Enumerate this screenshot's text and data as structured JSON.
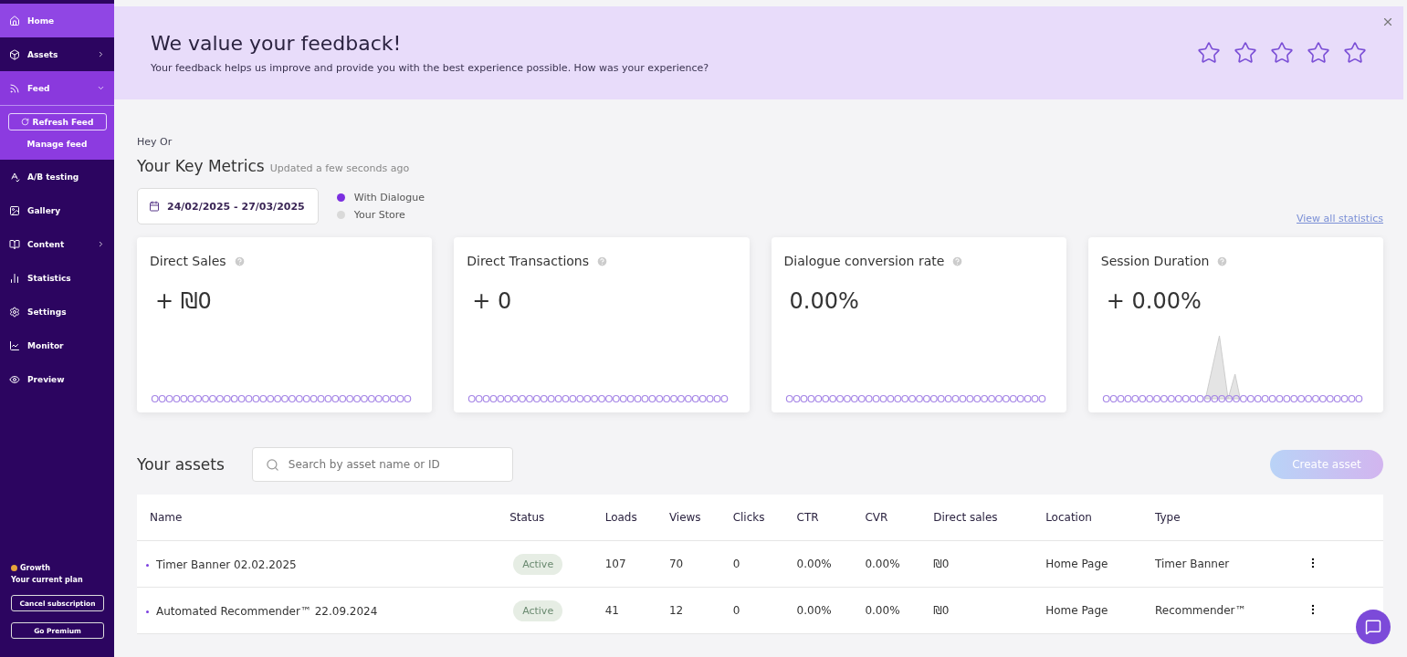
{
  "sidebar": {
    "items": [
      {
        "label": "Home",
        "selected": true
      },
      {
        "label": "Assets",
        "selected": false,
        "expanded": false
      },
      {
        "label": "Feed",
        "selected": false,
        "expanded": true,
        "children": [
          {
            "kind": "button",
            "label": "Refresh Feed"
          },
          {
            "kind": "link",
            "label": "Manage feed"
          }
        ]
      },
      {
        "label": "A/B testing",
        "selected": false
      },
      {
        "label": "Gallery",
        "selected": false
      },
      {
        "label": "Content",
        "selected": false,
        "expanded": false
      },
      {
        "label": "Statistics",
        "selected": false
      },
      {
        "label": "Settings",
        "selected": false
      },
      {
        "label": "Monitor",
        "selected": false
      },
      {
        "label": "Preview",
        "selected": false
      }
    ],
    "plan": {
      "name": "Growth",
      "caption": "Your current plan",
      "buttons": [
        "Cancel subscription",
        "Go Premium"
      ]
    }
  },
  "feedback": {
    "title": "We value your feedback!",
    "text": "Your feedback helps us improve and provide you with the best experience possible. How was your experience?",
    "stars": 0
  },
  "greeting": "Hey Or",
  "metrics": {
    "title": "Your Key Metrics",
    "updated": "Updated a few seconds ago",
    "date_range": "24/02/2025 - 27/03/2025",
    "legend": [
      {
        "label": "With Dialogue",
        "color": "#7b2fe0"
      },
      {
        "label": "Your Store",
        "color": "#d9d9d9"
      }
    ],
    "view_all": "View all statistics",
    "cards": [
      {
        "title": "Direct Sales",
        "value": "+ ₪0",
        "spikes": false
      },
      {
        "title": "Direct Transactions",
        "value": "+ 0",
        "spikes": false
      },
      {
        "title": "Dialogue conversion rate",
        "value": "0.00%",
        "spikes": false
      },
      {
        "title": "Session Duration",
        "value": "+ 0.00%",
        "spikes": true
      }
    ]
  },
  "assets": {
    "title": "Your assets",
    "search": {
      "placeholder": "Search by asset name or ID"
    },
    "create": "Create asset",
    "columns": [
      "Name",
      "Status",
      "Loads",
      "Views",
      "Clicks",
      "CTR",
      "CVR",
      "Direct sales",
      "Location",
      "Type"
    ],
    "rows": [
      {
        "cells": [
          "Timer Banner 02.02.2025",
          "Active",
          "107",
          "70",
          "0",
          "0.00%",
          "0.00%",
          "₪0",
          "Home Page",
          "Timer Banner"
        ]
      },
      {
        "cells": [
          "Automated Recommender™ 22.09.2024",
          "Active",
          "41",
          "12",
          "0",
          "0.00%",
          "0.00%",
          "₪0",
          "Home Page",
          "Recommender™"
        ]
      }
    ]
  }
}
